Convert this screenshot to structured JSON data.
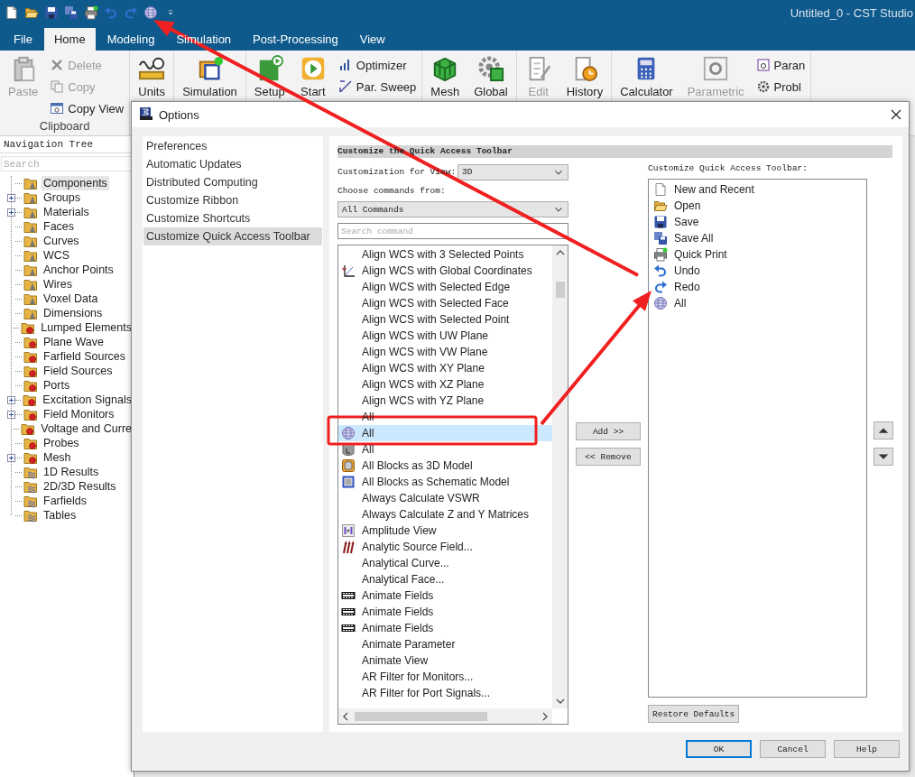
{
  "window": {
    "title": "Untitled_0 - CST Studio"
  },
  "quick_access": [
    {
      "kind": "new"
    },
    {
      "kind": "open"
    },
    {
      "kind": "save"
    },
    {
      "kind": "saveall"
    },
    {
      "kind": "print"
    },
    {
      "kind": "undo"
    },
    {
      "kind": "redo"
    },
    {
      "kind": "globe"
    },
    {
      "kind": "more"
    }
  ],
  "tabs": [
    {
      "label": "File",
      "selected": false
    },
    {
      "label": "Home",
      "selected": true
    },
    {
      "label": "Modeling",
      "selected": false
    },
    {
      "label": "Simulation",
      "selected": false
    },
    {
      "label": "Post-Processing",
      "selected": false
    },
    {
      "label": "View",
      "selected": false
    }
  ],
  "ribbon": {
    "groups": [
      {
        "label": "Clipboard",
        "items": [
          {
            "label": "Paste",
            "kind": "paste",
            "disabled": true
          },
          {
            "stack": [
              {
                "label": "Delete",
                "kind": "delete",
                "disabled": true
              },
              {
                "label": "Copy",
                "kind": "copy",
                "disabled": true
              },
              {
                "label": "Copy View",
                "kind": "copyview",
                "disabled": false
              }
            ]
          }
        ]
      },
      {
        "items": [
          {
            "label": "Units",
            "kind": "units",
            "disabled": false
          }
        ]
      },
      {
        "items": [
          {
            "label": "Simulation",
            "kind": "simulation",
            "disabled": false
          }
        ]
      },
      {
        "items": [
          {
            "label": "Setup",
            "kind": "setup",
            "disabled": false
          },
          {
            "label": "Start",
            "kind": "start",
            "disabled": false
          },
          {
            "stack": [
              {
                "label": "Optimizer",
                "kind": "optimizer",
                "disabled": false
              },
              {
                "label": "Par. Sweep",
                "kind": "sweep",
                "disabled": false
              }
            ]
          }
        ]
      },
      {
        "items": [
          {
            "label": "Mesh",
            "kind": "mesh",
            "disabled": false
          },
          {
            "label": "Global",
            "kind": "global",
            "disabled": false
          }
        ]
      },
      {
        "items": [
          {
            "label": "Edit",
            "kind": "edit",
            "disabled": true
          },
          {
            "label": "History",
            "kind": "history",
            "disabled": false
          }
        ]
      },
      {
        "items": [
          {
            "label": "Calculator",
            "kind": "calculator",
            "disabled": false
          },
          {
            "label": "Parametric",
            "kind": "parametric",
            "disabled": true
          },
          {
            "stack": [
              {
                "label": "Paran",
                "kind": "frame",
                "disabled": false
              },
              {
                "label": "Probl",
                "kind": "gear",
                "disabled": false
              }
            ]
          }
        ]
      }
    ]
  },
  "navigation_tree": {
    "title": "Navigation Tree",
    "search": {
      "placeholder": "Search"
    },
    "items": [
      {
        "label": "Components",
        "kind": "cone",
        "has_expander": false,
        "selected": true
      },
      {
        "label": "Groups",
        "kind": "cone",
        "has_expander": true,
        "selected": false
      },
      {
        "label": "Materials",
        "kind": "cone",
        "has_expander": true,
        "selected": false
      },
      {
        "label": "Faces",
        "kind": "cone",
        "has_expander": false,
        "selected": false
      },
      {
        "label": "Curves",
        "kind": "cone",
        "has_expander": false,
        "selected": false
      },
      {
        "label": "WCS",
        "kind": "cone",
        "has_expander": false,
        "selected": false
      },
      {
        "label": "Anchor Points",
        "kind": "cone",
        "has_expander": false,
        "selected": false
      },
      {
        "label": "Wires",
        "kind": "cone",
        "has_expander": false,
        "selected": false
      },
      {
        "label": "Voxel Data",
        "kind": "cone",
        "has_expander": false,
        "selected": false
      },
      {
        "label": "Dimensions",
        "kind": "cone",
        "has_expander": false,
        "selected": false
      },
      {
        "label": "Lumped Elements",
        "kind": "gear",
        "has_expander": false,
        "selected": false
      },
      {
        "label": "Plane Wave",
        "kind": "gear",
        "has_expander": false,
        "selected": false
      },
      {
        "label": "Farfield Sources",
        "kind": "gear",
        "has_expander": false,
        "selected": false
      },
      {
        "label": "Field Sources",
        "kind": "gear",
        "has_expander": false,
        "selected": false
      },
      {
        "label": "Ports",
        "kind": "gear",
        "has_expander": false,
        "selected": false
      },
      {
        "label": "Excitation Signals",
        "kind": "gear",
        "has_expander": true,
        "selected": false
      },
      {
        "label": "Field Monitors",
        "kind": "gear",
        "has_expander": true,
        "selected": false
      },
      {
        "label": "Voltage and Curre",
        "kind": "gear",
        "has_expander": false,
        "selected": false
      },
      {
        "label": "Probes",
        "kind": "gear",
        "has_expander": false,
        "selected": false
      },
      {
        "label": "Mesh",
        "kind": "gear",
        "has_expander": true,
        "selected": false
      },
      {
        "label": "1D Results",
        "kind": "results",
        "has_expander": false,
        "selected": false
      },
      {
        "label": "2D/3D Results",
        "kind": "results",
        "has_expander": false,
        "selected": false
      },
      {
        "label": "Farfields",
        "kind": "results",
        "has_expander": false,
        "selected": false
      },
      {
        "label": "Tables",
        "kind": "results",
        "has_expander": false,
        "selected": false
      }
    ]
  },
  "dialog": {
    "title": "Options",
    "sidebar": {
      "items": [
        {
          "label": "Preferences",
          "selected": false
        },
        {
          "label": "Automatic Updates",
          "selected": false
        },
        {
          "label": "Distributed Computing",
          "selected": false
        },
        {
          "label": "Customize Ribbon",
          "selected": false
        },
        {
          "label": "Customize Shortcuts",
          "selected": false
        },
        {
          "label": "Customize Quick Access Toolbar",
          "selected": true
        }
      ]
    },
    "heading": "Customize the Quick Access Toolbar",
    "view_label": "Customization for View:",
    "view_select": {
      "value": "3D"
    },
    "commands_label": "Choose commands from:",
    "commands_select": {
      "value": "All Commands"
    },
    "search": {
      "placeholder": "Search command"
    },
    "commands": [
      {
        "label": "Align WCS with 3 Selected Points",
        "kind": "none",
        "selected": false
      },
      {
        "label": "Align WCS with Global Coordinates",
        "kind": "axes",
        "selected": false
      },
      {
        "label": "Align WCS with Selected Edge",
        "kind": "none",
        "selected": false
      },
      {
        "label": "Align WCS with Selected Face",
        "kind": "none",
        "selected": false
      },
      {
        "label": "Align WCS with Selected Point",
        "kind": "none",
        "selected": false
      },
      {
        "label": "Align WCS with UW Plane",
        "kind": "none",
        "selected": false
      },
      {
        "label": "Align WCS with VW Plane",
        "kind": "none",
        "selected": false
      },
      {
        "label": "Align WCS with XY Plane",
        "kind": "none",
        "selected": false
      },
      {
        "label": "Align WCS with XZ Plane",
        "kind": "none",
        "selected": false
      },
      {
        "label": "Align WCS with YZ Plane",
        "kind": "none",
        "selected": false
      },
      {
        "label": "All",
        "kind": "none",
        "selected": false
      },
      {
        "label": "All",
        "kind": "globe",
        "selected": true
      },
      {
        "label": "All",
        "kind": "cylinder",
        "selected": false
      },
      {
        "label": "All Blocks as 3D Model",
        "kind": "cube",
        "selected": false
      },
      {
        "label": "All Blocks as Schematic Model",
        "kind": "schematic",
        "selected": false
      },
      {
        "label": "Always Calculate VSWR",
        "kind": "none",
        "selected": false
      },
      {
        "label": "Always Calculate Z and Y Matrices",
        "kind": "none",
        "selected": false
      },
      {
        "label": "Amplitude View",
        "kind": "amplitude",
        "selected": false
      },
      {
        "label": "Analytic Source Field...",
        "kind": "arrows",
        "selected": false
      },
      {
        "label": "Analytical Curve...",
        "kind": "none",
        "selected": false
      },
      {
        "label": "Analytical Face...",
        "kind": "none",
        "selected": false
      },
      {
        "label": "Animate Fields",
        "kind": "film",
        "selected": false
      },
      {
        "label": "Animate Fields",
        "kind": "film",
        "selected": false
      },
      {
        "label": "Animate Fields",
        "kind": "film",
        "selected": false
      },
      {
        "label": "Animate Parameter",
        "kind": "none",
        "selected": false
      },
      {
        "label": "Animate View",
        "kind": "none",
        "selected": false
      },
      {
        "label": "AR Filter for Monitors...",
        "kind": "none",
        "selected": false
      },
      {
        "label": "AR Filter for Port Signals...",
        "kind": "none",
        "selected": false
      }
    ],
    "add_button": "Add >>",
    "remove_button": "<< Remove",
    "toolbar_label": "Customize Quick Access Toolbar:",
    "toolbar_items": [
      {
        "label": "New and Recent",
        "kind": "new"
      },
      {
        "label": "Open",
        "kind": "open"
      },
      {
        "label": "Save",
        "kind": "save"
      },
      {
        "label": "Save All",
        "kind": "saveall"
      },
      {
        "label": "Quick Print",
        "kind": "print"
      },
      {
        "label": "Undo",
        "kind": "undo"
      },
      {
        "label": "Redo",
        "kind": "redo"
      },
      {
        "label": "All",
        "kind": "globe"
      }
    ],
    "restore_button": "Restore Defaults",
    "footer_buttons": [
      {
        "label": "OK",
        "focused": true
      },
      {
        "label": "Cancel",
        "focused": false
      },
      {
        "label": "Help",
        "focused": false
      }
    ]
  }
}
